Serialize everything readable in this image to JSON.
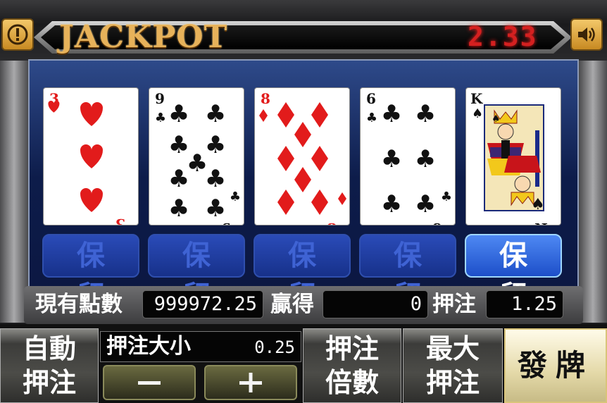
{
  "header": {
    "title": "JACKPOT",
    "jackpot_value": "2.33",
    "info_icon": "exclamation-icon",
    "sound_icon": "speaker-icon",
    "accent_color": "#e7b25a",
    "jackpot_color": "#d42020"
  },
  "cards": [
    {
      "rank": "3",
      "suit": "hearts",
      "color": "#e21b1b"
    },
    {
      "rank": "9",
      "suit": "clubs",
      "color": "#111111"
    },
    {
      "rank": "8",
      "suit": "diamonds",
      "color": "#e21b1b"
    },
    {
      "rank": "6",
      "suit": "clubs",
      "color": "#111111"
    },
    {
      "rank": "K",
      "suit": "spades",
      "color": "#111111"
    }
  ],
  "holds": [
    {
      "label": "保留",
      "held": false
    },
    {
      "label": "保留",
      "held": false
    },
    {
      "label": "保留",
      "held": false
    },
    {
      "label": "保留",
      "held": false
    },
    {
      "label": "保留",
      "held": true
    }
  ],
  "status": {
    "credits_label": "現有點數",
    "credits_value": "999972.25",
    "win_label": "贏得",
    "win_value": "0",
    "bet_label": "押注",
    "bet_value": "1.25"
  },
  "controls": {
    "auto_bet_line1": "自動",
    "auto_bet_line2": "押注",
    "bet_size_label": "押注大小",
    "bet_size_value": "0.25",
    "minus_icon": "minus-icon",
    "plus_icon": "plus-icon",
    "multiplier_line1": "押注",
    "multiplier_line2": "倍數",
    "max_bet_line1": "最大",
    "max_bet_line2": "押注",
    "deal_label": "發牌"
  }
}
